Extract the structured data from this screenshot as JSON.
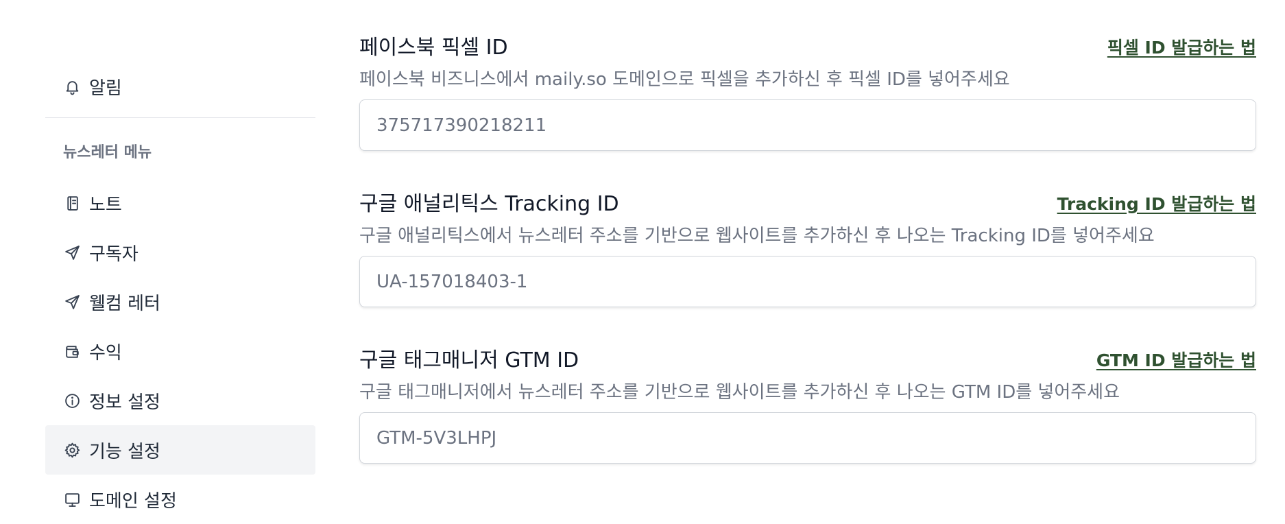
{
  "sidebar": {
    "notifications_label": "알림",
    "section_label": "뉴스레터 메뉴",
    "items": [
      {
        "label": "노트",
        "icon": "notebook-icon"
      },
      {
        "label": "구독자",
        "icon": "paper-plane-icon"
      },
      {
        "label": "웰컴 레터",
        "icon": "paper-plane-icon"
      },
      {
        "label": "수익",
        "icon": "wallet-icon"
      },
      {
        "label": "정보 설정",
        "icon": "info-circle-icon"
      },
      {
        "label": "기능 설정",
        "icon": "gear-icon",
        "active": true
      },
      {
        "label": "도메인 설정",
        "icon": "monitor-icon"
      }
    ]
  },
  "fields": [
    {
      "title": "페이스북 픽셀 ID",
      "link": "픽셀 ID 발급하는 법",
      "description": "페이스북 비즈니스에서 maily.so 도메인으로 픽셀을 추가하신 후 픽셀 ID를 넣어주세요",
      "value": "375717390218211"
    },
    {
      "title": "구글 애널리틱스 Tracking ID",
      "link": "Tracking ID 발급하는 법",
      "description": "구글 애널리틱스에서 뉴스레터 주소를 기반으로 웹사이트를 추가하신 후 나오는 Tracking ID를 넣어주세요",
      "value": "UA-157018403-1"
    },
    {
      "title": "구글 태그매니저 GTM ID",
      "link": "GTM ID 발급하는 법",
      "description": "구글 태그매니저에서 뉴스레터 주소를 기반으로 웹사이트를 추가하신 후 나오는 GTM ID를 넣어주세요",
      "value": "GTM-5V3LHPJ"
    }
  ],
  "colors": {
    "link": "#2f5130",
    "active_bg": "#f3f4f6",
    "muted_text": "#6b7280"
  }
}
